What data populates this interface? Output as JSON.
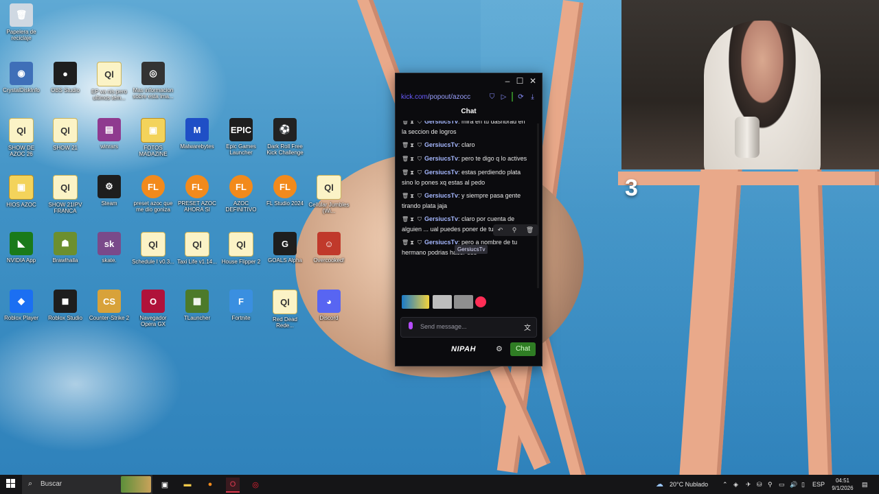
{
  "desktop": {
    "icons": [
      {
        "label": "Papelera de reciclaje",
        "icon": "recycle-bin-icon",
        "glyph": "🗑"
      },
      {
        "label": "CrystalDiskInfo",
        "icon": "crystaldiskinfo-icon",
        "glyph": "◉"
      },
      {
        "label": "OBS Studio",
        "icon": "obs-icon",
        "glyph": "●"
      },
      {
        "label": "EP va nis pero ultimos tem...",
        "icon": "file-icon",
        "glyph": "Ql"
      },
      {
        "label": "Mas informacion sobre esta ima...",
        "icon": "camera-icon",
        "glyph": "◎"
      },
      {
        "label": "SHOW DE AZOC 26",
        "icon": "file-icon",
        "glyph": "Ql"
      },
      {
        "label": "SHOW 21",
        "icon": "file-icon",
        "glyph": "Ql"
      },
      {
        "label": "winrars",
        "icon": "winrar-icon",
        "glyph": "▤"
      },
      {
        "label": "FOTOS MADAZINE",
        "icon": "folder-icon",
        "glyph": "▣"
      },
      {
        "label": "Malwarebytes",
        "icon": "malwarebytes-icon",
        "glyph": "M"
      },
      {
        "label": "Epic Games Launcher",
        "icon": "epic-games-icon",
        "glyph": "EPIC"
      },
      {
        "label": "Dark Roll Free Kick Challenge",
        "icon": "soccer-ball-icon",
        "glyph": "⚽"
      },
      {
        "label": "HIOS AZOC",
        "icon": "folder-icon",
        "glyph": "▣"
      },
      {
        "label": "SHOW 21IPV FRANCA",
        "icon": "file-icon",
        "glyph": "Ql"
      },
      {
        "label": "Steam",
        "icon": "steam-icon",
        "glyph": "⚙"
      },
      {
        "label": "preset azoc que me dio goniza",
        "icon": "fl-studio-icon",
        "glyph": "FL"
      },
      {
        "label": "PRESET AZOC AHORA SI",
        "icon": "fl-studio-icon",
        "glyph": "FL"
      },
      {
        "label": "AZOC DEFINITIVO",
        "icon": "fl-studio-icon",
        "glyph": "FL"
      },
      {
        "label": "FL Studio 2024",
        "icon": "fl-studio-icon",
        "glyph": "FL"
      },
      {
        "label": "Cellular Jumbles (Wi...",
        "icon": "file-icon",
        "glyph": "Ql"
      },
      {
        "label": "NVIDIA App",
        "icon": "nvidia-icon",
        "glyph": "◣"
      },
      {
        "label": "Brawlhalla",
        "icon": "brawlhalla-icon",
        "glyph": "☗"
      },
      {
        "label": "skate.",
        "icon": "skate-icon",
        "glyph": "sk"
      },
      {
        "label": "Schedule I v0.3...",
        "icon": "file-icon",
        "glyph": "Ql"
      },
      {
        "label": "Taxi Life v1.14...",
        "icon": "file-icon",
        "glyph": "Ql"
      },
      {
        "label": "House Flipper 2",
        "icon": "file-icon",
        "glyph": "Ql"
      },
      {
        "label": "GOALS Alpha",
        "icon": "goals-icon",
        "glyph": "G"
      },
      {
        "label": "Overcooked!",
        "icon": "overcooked-icon",
        "glyph": "☺"
      },
      {
        "label": "Roblox Player",
        "icon": "roblox-player-icon",
        "glyph": "◆"
      },
      {
        "label": "Roblox Studio",
        "icon": "roblox-studio-icon",
        "glyph": "◼"
      },
      {
        "label": "Counter-Strike 2",
        "icon": "counter-strike-icon",
        "glyph": "CS"
      },
      {
        "label": "Navegador Opera GX",
        "icon": "opera-gx-icon",
        "glyph": "O"
      },
      {
        "label": "TLauncher",
        "icon": "tlauncher-icon",
        "glyph": "▦"
      },
      {
        "label": "Fortnite",
        "icon": "fortnite-icon",
        "glyph": "F"
      },
      {
        "label": "Red Dead Rede...",
        "icon": "file-icon",
        "glyph": "Ql"
      },
      {
        "label": "Discord",
        "icon": "discord-icon",
        "glyph": "◕"
      }
    ]
  },
  "webcam": {
    "overlay_number": "3"
  },
  "chat_window": {
    "url_host": "kick.com",
    "url_path": "/popout/azocc",
    "header_title": "Chat",
    "messages": [
      {
        "user": "GersiucsTv",
        "text": "mira en tu dashbrad en la seccion de logros"
      },
      {
        "user": "GersiucsTv",
        "text": "claro"
      },
      {
        "user": "GersiucsTv",
        "text": "pero te digo q lo actives"
      },
      {
        "user": "GersiucsTv",
        "text": "estas perdiendo plata sino lo pones xq estas al pedo"
      },
      {
        "user": "GersiucsTv",
        "text": "y siempre pasa gente tirando plata jaja"
      },
      {
        "user": "GersiucsTv",
        "text": "claro por cuenta de alguien ... ual puedes poner de tu mp cre..."
      },
      {
        "user": "GersiucsTv",
        "text": "pero a nombre de tu hermano podrias hacer eso"
      }
    ],
    "tooltip": "GersiucsTv",
    "input_placeholder": "Send message...",
    "brand": "NIPAH",
    "send_label": "Chat"
  },
  "taskbar": {
    "search_placeholder": "Buscar",
    "weather": "20°C  Nublado",
    "language": "ESP",
    "time": "04:51",
    "date": "9/1/2026"
  },
  "colors": {
    "kick_green": "#2f7d24",
    "username": "#a6b8ff",
    "link": "#6a5cff"
  }
}
